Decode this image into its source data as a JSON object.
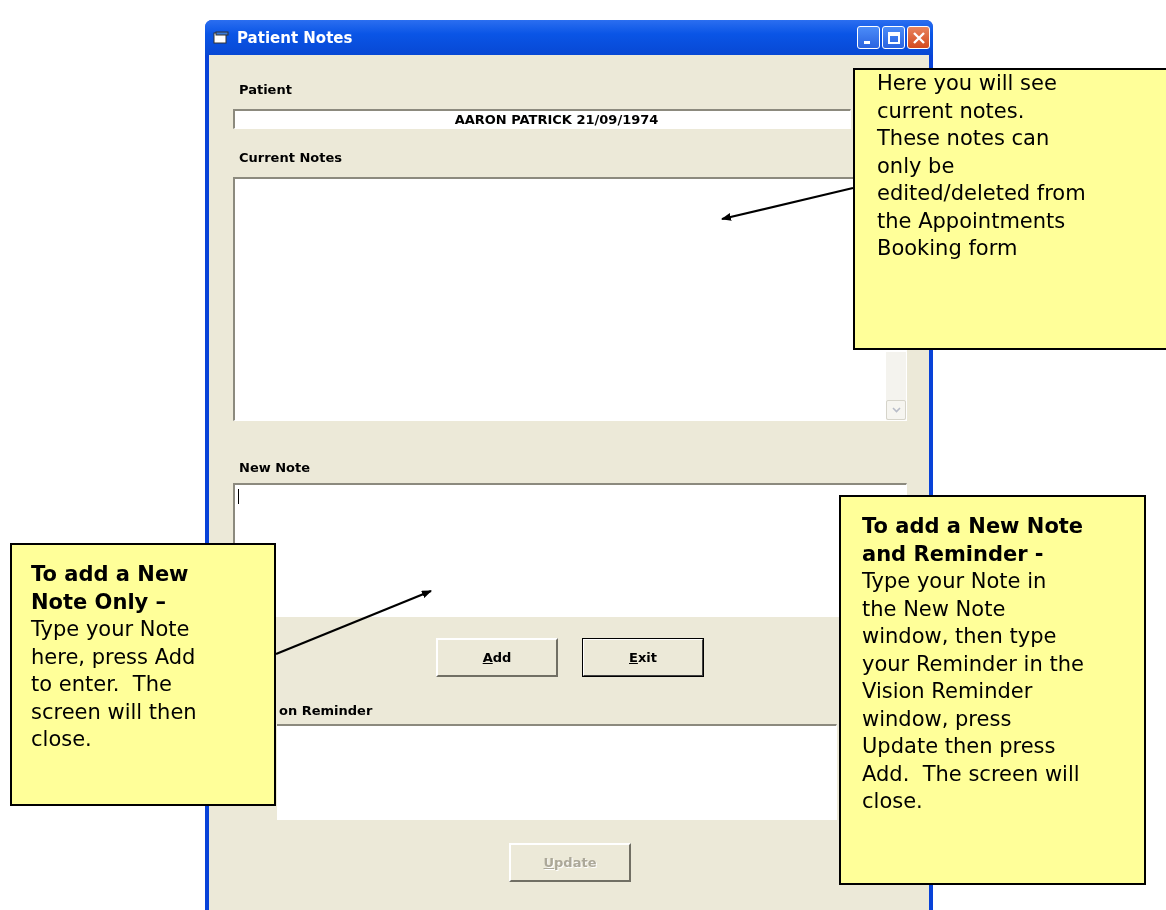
{
  "window": {
    "title": "Patient Notes"
  },
  "patient": {
    "label": "Patient",
    "value": "AARON PATRICK 21/09/1974"
  },
  "current_notes": {
    "label": "Current Notes"
  },
  "new_note": {
    "label": "New Note"
  },
  "buttons": [
    {
      "label": "Add",
      "disabled": false,
      "default": false
    },
    {
      "label": "Exit",
      "disabled": false,
      "default": true
    }
  ],
  "vision_reminder": {
    "label": "on Reminder"
  },
  "update_button": {
    "label": "Update",
    "disabled": true
  },
  "callouts": [
    {
      "kind": "top",
      "text": "Here you will see\ncurrent notes.\nThese notes can\nonly be\nedited/deleted from\nthe Appointments\nBooking form"
    },
    {
      "kind": "left",
      "heading": "To add a New\nNote Only –",
      "text": "Type your Note\nhere, press Add\nto enter.  The\nscreen will then\nclose."
    },
    {
      "kind": "right",
      "heading": "To add a New Note\nand Reminder -",
      "text": "Type your Note in\nthe New Note\nwindow, then type\nyour Reminder in the\nVision Reminder\nwindow, press\nUpdate then press\nAdd.  The screen will\nclose."
    }
  ]
}
